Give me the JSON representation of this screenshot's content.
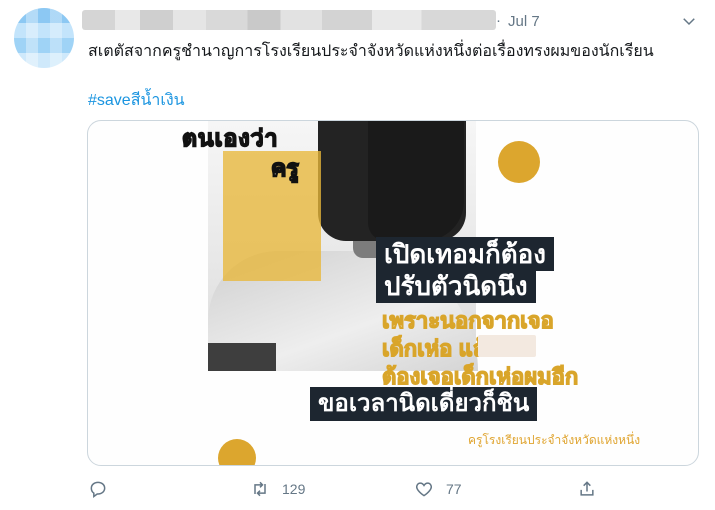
{
  "tweet": {
    "separator": "·",
    "date": "Jul 7",
    "text": "สเตตัสจากครูชำนาญการโรงเรียนประจำจังหวัดแห่งหนึ่งต่อเรื่องทรงผมของนักเรียน",
    "hashtag": "#saveสีน้ำเงิน"
  },
  "card": {
    "heading_line1": "ตนเองว่า",
    "heading_line2": "ครู",
    "box_line1": "เปิดเทอมก็ต้อง",
    "box_line2": "ปรับตัวนิดนึง",
    "yellow_line1": "เพราะนอกจากเจอ",
    "yellow_line2": "เด็กเห่อ           แล้ว",
    "yellow_line3": "ต้องเจอเด็กเห่อผมอีก",
    "box_line3": "ขอเวลานิดเดี่ยวก็ชิน",
    "credit": "ครูโรงเรียนประจำจังหวัดแห่งหนึ่ง",
    "accent_color": "#dca62e"
  },
  "actions": {
    "retweets": "129",
    "likes": "77"
  }
}
